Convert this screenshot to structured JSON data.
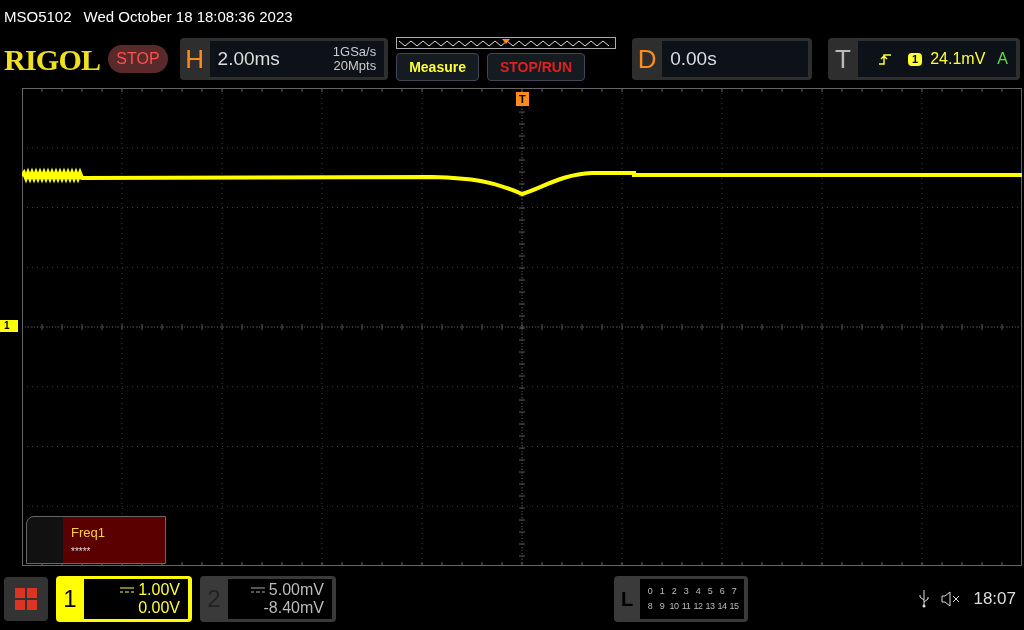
{
  "title_bar": {
    "model": "MSO5102",
    "datetime": "Wed October 18 18:08:36 2023"
  },
  "header": {
    "logo": "RIGOL",
    "run_state": "STOP",
    "horizontal": {
      "label": "H",
      "timebase": "2.00ms",
      "sample_rate": "1GSa/s",
      "memory_depth": "20Mpts"
    },
    "buttons": [
      {
        "label": "Measure",
        "kind": "measure"
      },
      {
        "label": "STOP/RUN",
        "kind": "run"
      }
    ],
    "delay": {
      "label": "D",
      "value": "0.00s"
    },
    "trigger": {
      "label": "T",
      "source": "1",
      "level": "24.1mV",
      "mode": "A"
    }
  },
  "grid": {
    "trigger_marker": "T",
    "channel_marker": "1"
  },
  "measurement": {
    "name": "Freq1",
    "value": "*****"
  },
  "channels": [
    {
      "number": "1",
      "scale": "1.00V",
      "offset": "0.00V",
      "selected": true
    },
    {
      "number": "2",
      "scale": "5.00mV",
      "offset": "-8.40mV",
      "selected": false
    }
  ],
  "logic": {
    "label": "L",
    "rows": [
      [
        "0",
        "1",
        "2",
        "3",
        "4",
        "5",
        "6",
        "7"
      ],
      [
        "8",
        "9",
        "10",
        "11",
        "12",
        "13",
        "14",
        "15"
      ]
    ]
  },
  "status": {
    "time": "18:07"
  }
}
